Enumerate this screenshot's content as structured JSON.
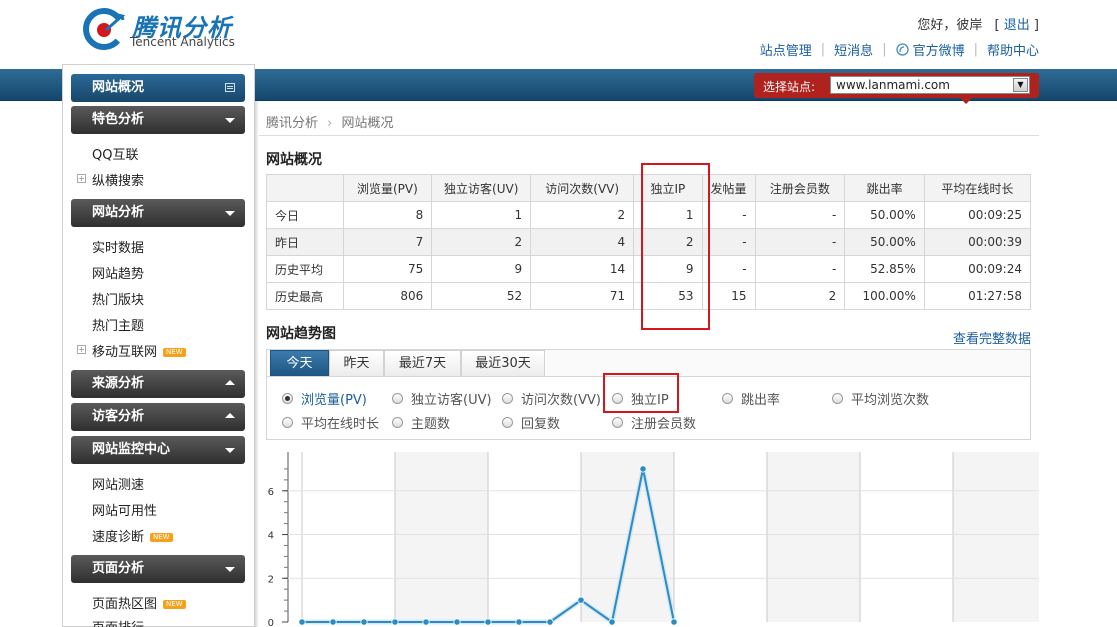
{
  "header": {
    "logo_cn": "腾讯分析",
    "logo_en": "Tencent Analytics",
    "greeting": "您好，彼岸",
    "logout_open": "[",
    "logout": "退出",
    "logout_close": "]",
    "nav": [
      "站点管理",
      "短消息",
      "官方微博",
      "帮助中心"
    ]
  },
  "site_selector": {
    "label": "选择站点:",
    "value": "www.lanmami.com"
  },
  "sidebar": {
    "sections": [
      {
        "title": "网站概况",
        "items": []
      },
      {
        "title": "特色分析",
        "items": [
          "QQ互联",
          "纵横搜索"
        ]
      },
      {
        "title": "网站分析",
        "items": [
          "实时数据",
          "网站趋势",
          "热门版块",
          "热门主题",
          "移动互联网"
        ]
      },
      {
        "title": "来源分析",
        "items": []
      },
      {
        "title": "访客分析",
        "items": []
      },
      {
        "title": "网站监控中心",
        "items": [
          "网站测速",
          "网站可用性",
          "速度诊断"
        ]
      },
      {
        "title": "页面分析",
        "items": [
          "页面热区图",
          "页面排行"
        ]
      }
    ],
    "new_badge": "NEW"
  },
  "breadcrumb": {
    "root": "腾讯分析",
    "sep": "›",
    "current": "网站概况"
  },
  "overview": {
    "title": "网站概况",
    "columns": [
      "",
      "浏览量(PV)",
      "独立访客(UV)",
      "访问次数(VV)",
      "独立IP",
      "发帖量",
      "注册会员数",
      "跳出率",
      "平均在线时长"
    ],
    "rows": [
      [
        "今日",
        "8",
        "1",
        "2",
        "1",
        "-",
        "-",
        "50.00%",
        "00:09:25"
      ],
      [
        "昨日",
        "7",
        "2",
        "4",
        "2",
        "-",
        "-",
        "50.00%",
        "00:00:39"
      ],
      [
        "历史平均",
        "75",
        "9",
        "14",
        "9",
        "-",
        "-",
        "52.85%",
        "00:09:24"
      ],
      [
        "历史最高",
        "806",
        "52",
        "71",
        "53",
        "15",
        "2",
        "100.00%",
        "01:27:58"
      ]
    ]
  },
  "trend": {
    "title": "网站趋势图",
    "full_data_link": "查看完整数据",
    "tabs": [
      "今天",
      "昨天",
      "最近7天",
      "最近30天"
    ],
    "active_tab": 0,
    "metrics": [
      "浏览量(PV)",
      "独立访客(UV)",
      "访问次数(VV)",
      "独立IP",
      "跳出率",
      "平均浏览次数",
      "平均在线时长",
      "主题数",
      "回复数",
      "注册会员数"
    ],
    "selected_metric": 0
  },
  "chart_data": {
    "type": "line",
    "title": "",
    "xlabel": "",
    "ylabel": "",
    "y_ticks": [
      0,
      2,
      4,
      6
    ],
    "ylim": [
      0,
      7.5
    ],
    "grid": true,
    "series": [
      {
        "values": [
          0,
          0,
          0,
          0,
          0,
          0,
          0,
          0,
          0,
          1,
          0,
          7,
          0
        ]
      }
    ],
    "color": "#2b8cc4"
  }
}
